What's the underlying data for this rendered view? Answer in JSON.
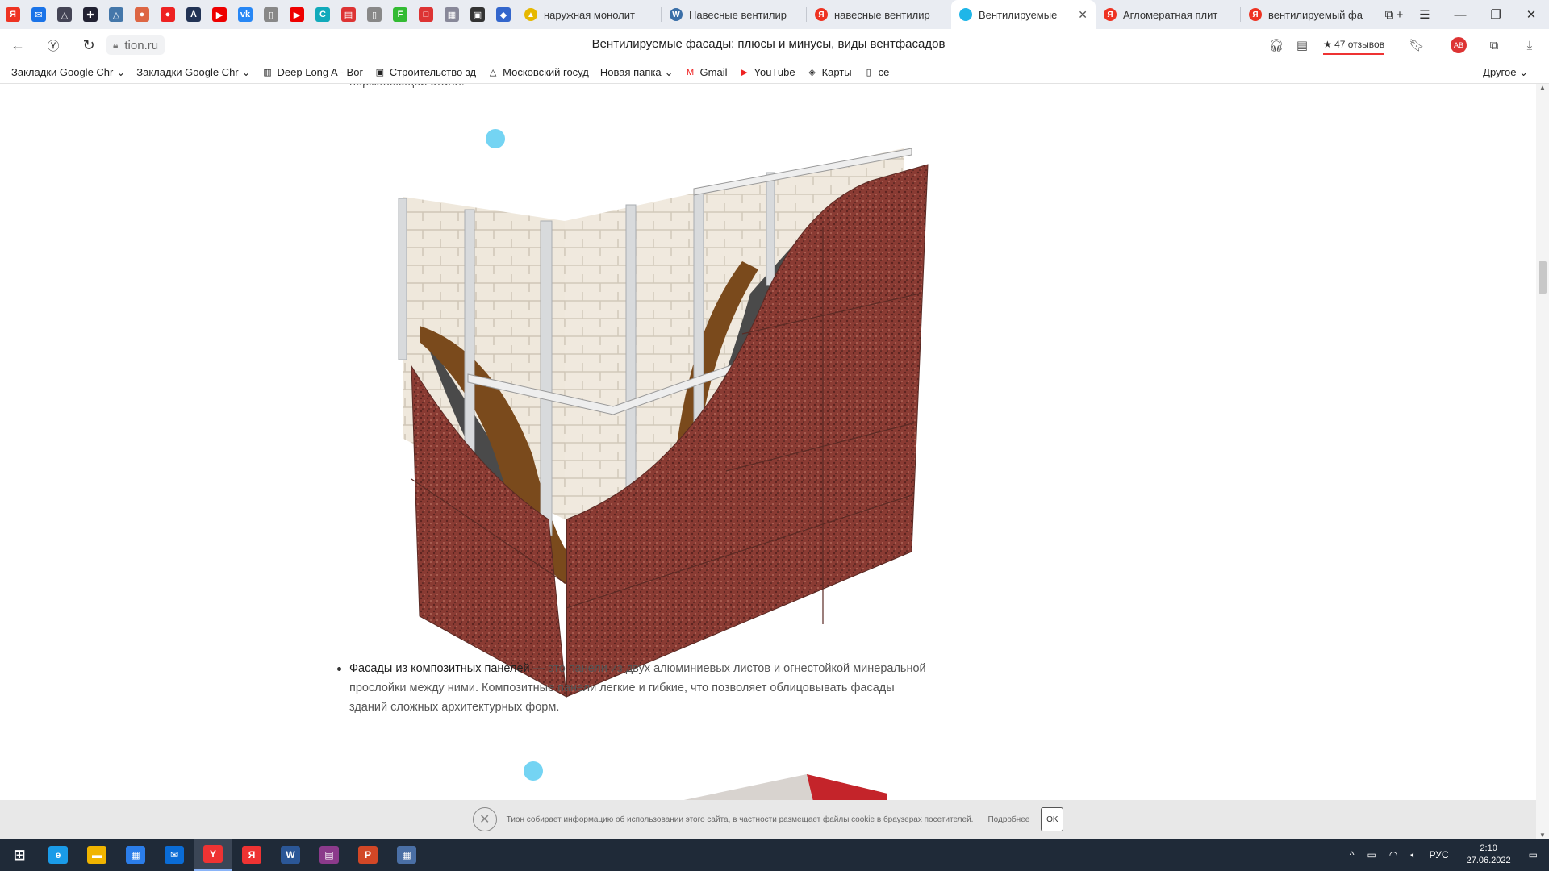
{
  "browser": {
    "pinned_tabs": [
      {
        "icon": "yandex-icon",
        "glyph": "Я",
        "color": "#e32"
      },
      {
        "icon": "mail-icon",
        "glyph": "✉",
        "color": "#1a73e8"
      },
      {
        "icon": "warning-icon",
        "glyph": "△",
        "color": "#445"
      },
      {
        "icon": "plus-star-icon",
        "glyph": "✚",
        "color": "#223"
      },
      {
        "icon": "flask-icon",
        "glyph": "△",
        "color": "#47a"
      },
      {
        "icon": "chart-icon",
        "glyph": "●",
        "color": "#d64"
      },
      {
        "icon": "red-drop-icon",
        "glyph": "●",
        "color": "#e22"
      },
      {
        "icon": "letter-a-icon",
        "glyph": "A",
        "color": "#235"
      },
      {
        "icon": "youtube-icon",
        "glyph": "▶",
        "color": "#e00"
      },
      {
        "icon": "vk-icon",
        "glyph": "vk",
        "color": "#2787f5"
      },
      {
        "icon": "document-icon",
        "glyph": "▯",
        "color": "#888"
      },
      {
        "icon": "youtube-icon",
        "glyph": "▶",
        "color": "#e00"
      },
      {
        "icon": "refresh-c-icon",
        "glyph": "C",
        "color": "#1ab"
      },
      {
        "icon": "pdf-icon",
        "glyph": "▤",
        "color": "#d33"
      },
      {
        "icon": "document-icon",
        "glyph": "▯",
        "color": "#888"
      },
      {
        "icon": "green-f-icon",
        "glyph": "F",
        "color": "#3b3"
      },
      {
        "icon": "note-icon",
        "glyph": "□",
        "color": "#d33"
      },
      {
        "icon": "image-icon",
        "glyph": "▦",
        "color": "#889"
      },
      {
        "icon": "printer-icon",
        "glyph": "▣",
        "color": "#333"
      },
      {
        "icon": "cube-icon",
        "glyph": "◆",
        "color": "#36c"
      }
    ],
    "tabs": [
      {
        "title": "наружная монолит",
        "icon": "image-icon",
        "color": "#e6b800",
        "glyph": "▲",
        "active": false
      },
      {
        "title": "Навесные вентилир",
        "icon": "wordpress-icon",
        "color": "#3a6fa8",
        "glyph": "W",
        "active": false
      },
      {
        "title": "навесные вентилир",
        "icon": "yandex-icon",
        "color": "#e32",
        "glyph": "Я",
        "active": false
      },
      {
        "title": "Вентилируемые",
        "icon": "tion-icon",
        "color": "#1fb6e8",
        "glyph": "",
        "active": true
      },
      {
        "title": "Агломератная плит",
        "icon": "yandex-icon",
        "color": "#e32",
        "glyph": "Я",
        "active": false
      },
      {
        "title": "вентилируемый фа",
        "icon": "yandex-icon",
        "color": "#e32",
        "glyph": "Я",
        "active": false
      }
    ],
    "url": "tion.ru",
    "page_title": "Вентилируемые фасады: плюсы и минусы, виды вентфасадов",
    "reviews": "★ 47 отзывов",
    "bookmarks": [
      {
        "label": "Закладки Google Chr",
        "icon": "",
        "chevron": true
      },
      {
        "label": "Закладки Google Chr",
        "icon": "",
        "chevron": true
      },
      {
        "label": "Deep Long A - Bor",
        "icon": "▥",
        "chevron": false
      },
      {
        "label": "Строительство зд",
        "icon": "▣",
        "chevron": false
      },
      {
        "label": "Московский госуд",
        "icon": "△",
        "chevron": false
      },
      {
        "label": "Новая папка",
        "icon": "",
        "chevron": true
      },
      {
        "label": "Gmail",
        "icon": "M",
        "chevron": false
      },
      {
        "label": "YouTube",
        "icon": "▶",
        "chevron": false
      },
      {
        "label": "Карты",
        "icon": "◈",
        "chevron": false
      },
      {
        "label": "ce",
        "icon": "▯",
        "chevron": false
      }
    ],
    "other_bookmarks": "Другое"
  },
  "article": {
    "top_fragment": "нержавеющей стали.",
    "image_alt": "Схема вентилируемого фасада с облицовкой из керамогранита",
    "bullet_bold": "Фасады из композитных панелей",
    "bullet_line1_rest": " — это панели из двух алюминиевых листов и огнестойкой минеральной",
    "bullet_line2": "прослойки между ними. Композитные панели легкие и гибкие, что позволяет облицовывать фасады",
    "bullet_line3": "зданий сложных архитектурных форм."
  },
  "cookie": {
    "text": "Тион собирает информацию об использовании этого сайта, в частности размещает файлы cookie в браузерах посетителей.",
    "link": "Подробнее",
    "ok": "OK"
  },
  "taskbar": {
    "apps": [
      {
        "name": "edge-icon",
        "color": "#1a9be8",
        "glyph": "e"
      },
      {
        "name": "folder-icon",
        "color": "#f0b400",
        "glyph": "▬"
      },
      {
        "name": "store-icon",
        "color": "#2b7de9",
        "glyph": "▦"
      },
      {
        "name": "mail-app-icon",
        "color": "#0a6cd6",
        "glyph": "✉"
      },
      {
        "name": "yandex-browser-icon",
        "color": "#e33",
        "glyph": "Y",
        "active": true
      },
      {
        "name": "yandex-icon",
        "color": "#e33",
        "glyph": "Я"
      },
      {
        "name": "word-icon",
        "color": "#2b5797",
        "glyph": "W"
      },
      {
        "name": "winrar-icon",
        "color": "#8b3a8b",
        "glyph": "▤"
      },
      {
        "name": "powerpoint-icon",
        "color": "#d24726",
        "glyph": "P"
      },
      {
        "name": "calculator-icon",
        "color": "#4a6fa5",
        "glyph": "▦"
      }
    ],
    "lang": "РУС",
    "time": "2:10",
    "date": "27.06.2022"
  }
}
